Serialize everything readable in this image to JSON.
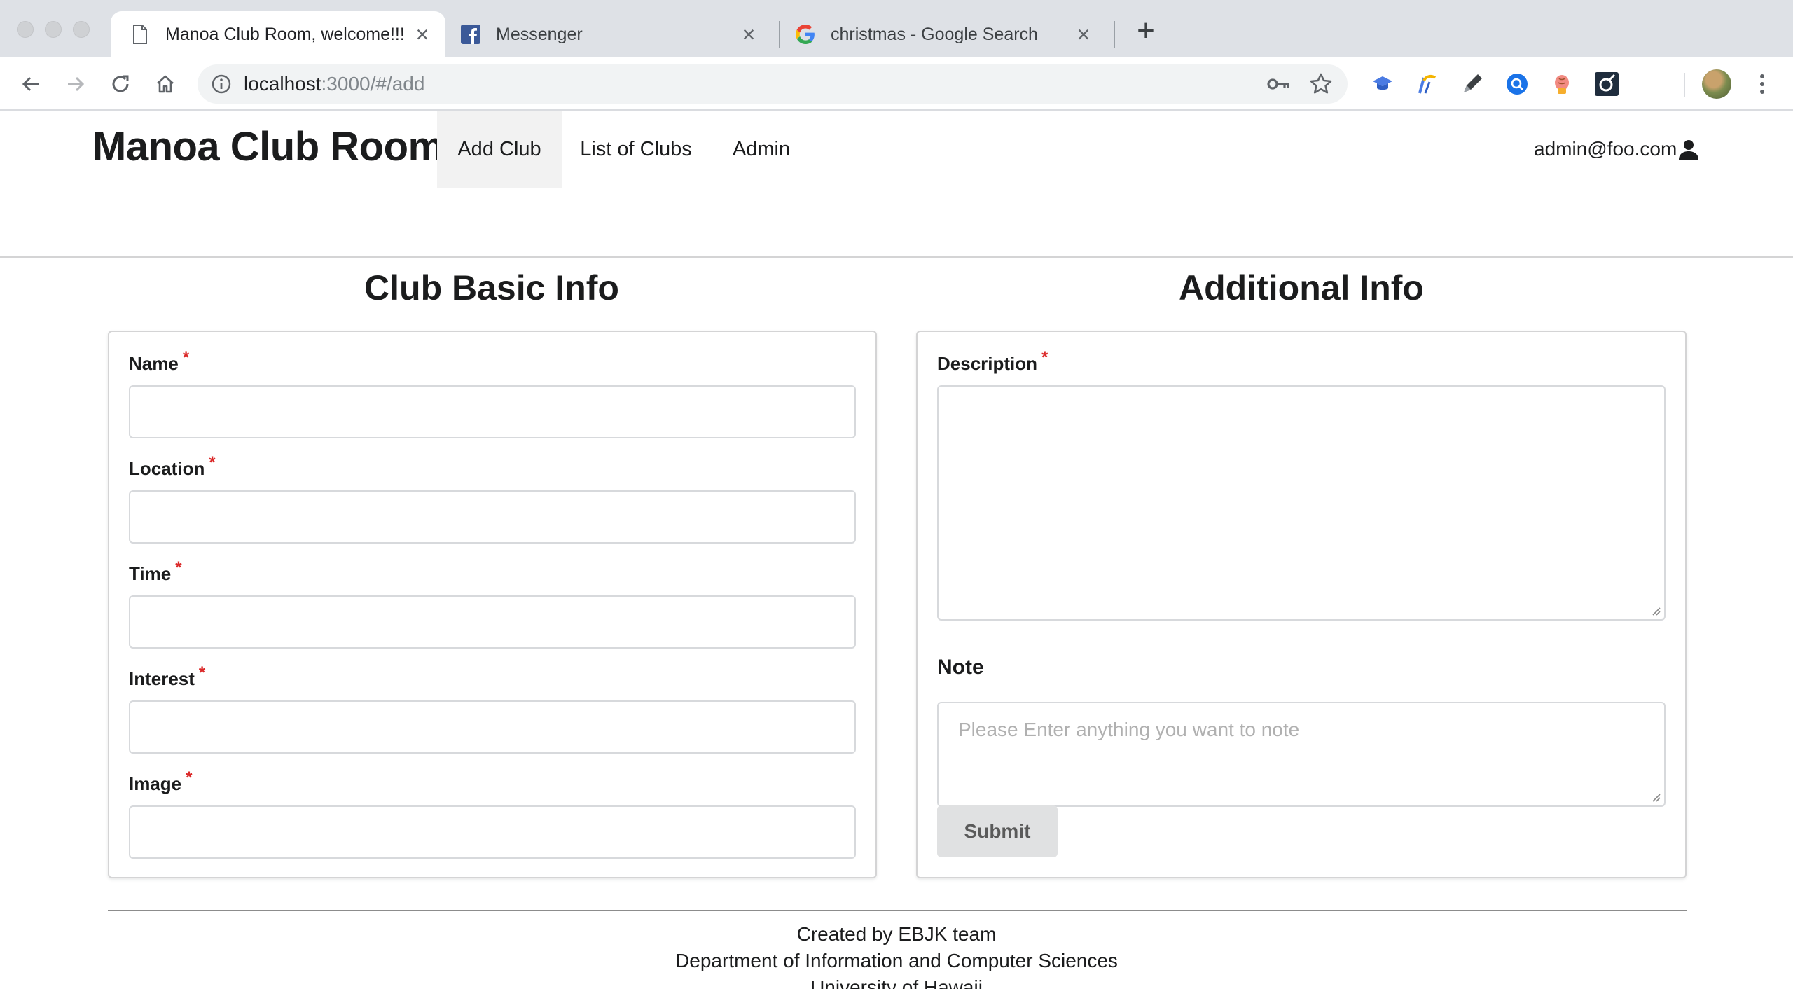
{
  "browser": {
    "tabs": [
      {
        "title": "Manoa Club Room, welcome!!!",
        "icon": "page-icon",
        "active": true
      },
      {
        "title": "Messenger",
        "icon": "facebook-icon",
        "active": false
      },
      {
        "title": "christmas - Google Search",
        "icon": "google-icon",
        "active": false
      }
    ],
    "new_tab_glyph": "+",
    "close_glyph": "×",
    "url_host": "localhost",
    "url_path": ":3000/#/add",
    "colors": {
      "chrome_bg": "#dee1e6",
      "omnibox_bg": "#f1f3f4"
    }
  },
  "app": {
    "brand": "Manoa Club Room",
    "nav": {
      "add_club": "Add Club",
      "list_clubs": "List of Clubs",
      "admin": "Admin"
    },
    "user_email": "admin@foo.com"
  },
  "form": {
    "left_title": "Club Basic Info",
    "right_title": "Additional Info",
    "required_mark": "*",
    "fields": {
      "name": "Name",
      "location": "Location",
      "time": "Time",
      "interest": "Interest",
      "image": "Image",
      "description": "Description",
      "note": "Note"
    },
    "note_placeholder": "Please Enter anything you want to note",
    "submit": "Submit",
    "colors": {
      "required": "#db2828",
      "submit_bg": "#e0e1e2"
    }
  },
  "footer": {
    "line1": "Created by EBJK team",
    "line2": "Department of Information and Computer Sciences",
    "line3": "University of Hawaii"
  }
}
